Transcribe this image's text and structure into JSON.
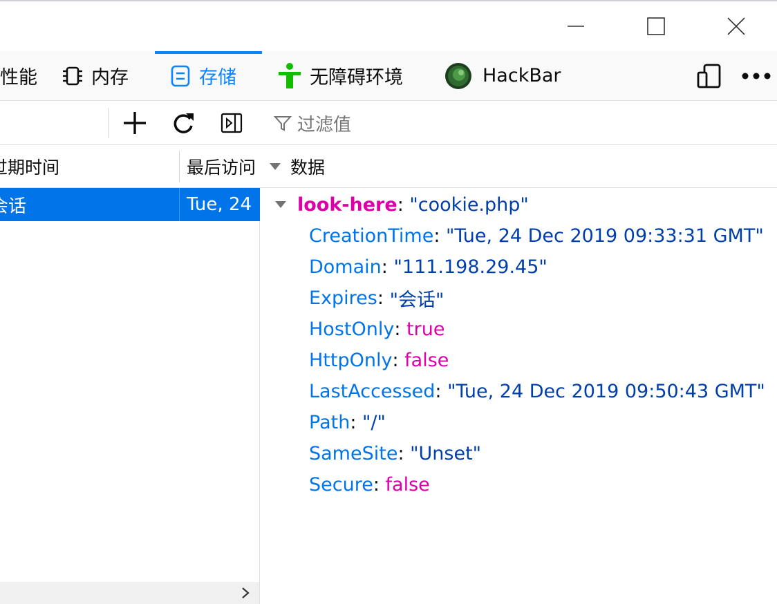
{
  "window": {
    "controls": [
      "minimize",
      "maximize",
      "close"
    ]
  },
  "tabs": [
    {
      "label": "性能",
      "icon": "performance-icon"
    },
    {
      "label": "内存",
      "icon": "memory-chip-icon"
    },
    {
      "label": "存储",
      "icon": "storage-icon",
      "active": true
    },
    {
      "label": "无障碍环境",
      "icon": "accessibility-icon"
    },
    {
      "label": "HackBar",
      "icon": "hackbar-logo-icon"
    }
  ],
  "toolbar": {
    "filter_placeholder": "过滤值"
  },
  "table": {
    "columns": [
      "过期时间",
      "最后访问"
    ],
    "rows": [
      {
        "expires": "会话",
        "last_accessed": "Tue, 24"
      }
    ]
  },
  "sidebar": {
    "header": "数据",
    "root_key": "look-here",
    "root_value": "\"cookie.php\"",
    "props": [
      {
        "key": "CreationTime",
        "value": "\"Tue, 24 Dec 2019 09:33:31 GMT\"",
        "kind": "string"
      },
      {
        "key": "Domain",
        "value": "\"111.198.29.45\"",
        "kind": "string"
      },
      {
        "key": "Expires",
        "value": "\"会话\"",
        "kind": "string"
      },
      {
        "key": "HostOnly",
        "value": "true",
        "kind": "bool"
      },
      {
        "key": "HttpOnly",
        "value": "false",
        "kind": "bool"
      },
      {
        "key": "LastAccessed",
        "value": "\"Tue, 24 Dec 2019 09:50:43 GMT\"",
        "kind": "string"
      },
      {
        "key": "Path",
        "value": "\"/\"",
        "kind": "string"
      },
      {
        "key": "SameSite",
        "value": "\"Unset\"",
        "kind": "string"
      },
      {
        "key": "Secure",
        "value": "false",
        "kind": "bool"
      }
    ]
  },
  "colors": {
    "accent": "#0a84ff",
    "selected_row": "#0074e8",
    "key": "#0074e8",
    "string": "#003eaa",
    "bool": "#dd00a9"
  }
}
